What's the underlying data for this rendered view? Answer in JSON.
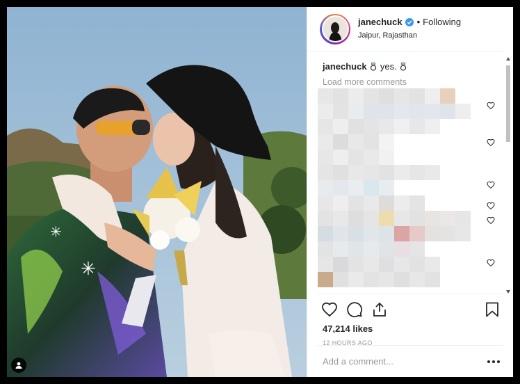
{
  "post": {
    "username": "janechuck",
    "follow_status": "Following",
    "separator": "•",
    "location": "Jaipur, Rajasthan",
    "verified": true,
    "caption_user": "janechuck",
    "caption_text": "yes.",
    "caption_emoji": "ring",
    "load_more_label": "Load more comments",
    "likes": "47,214 likes",
    "timestamp": "12 HOURS AGO",
    "comment_placeholder": "Add a comment..."
  },
  "colors": {
    "verified_blue": "#3897f0",
    "muted_text": "#999999",
    "primary_text": "#262626"
  },
  "icons": {
    "like": "heart-outline-icon",
    "comment": "speech-bubble-icon",
    "share": "share-upload-icon",
    "save": "bookmark-icon",
    "more": "ellipsis-icon",
    "tag": "user-tag-icon",
    "verified": "verified-badge-icon"
  }
}
